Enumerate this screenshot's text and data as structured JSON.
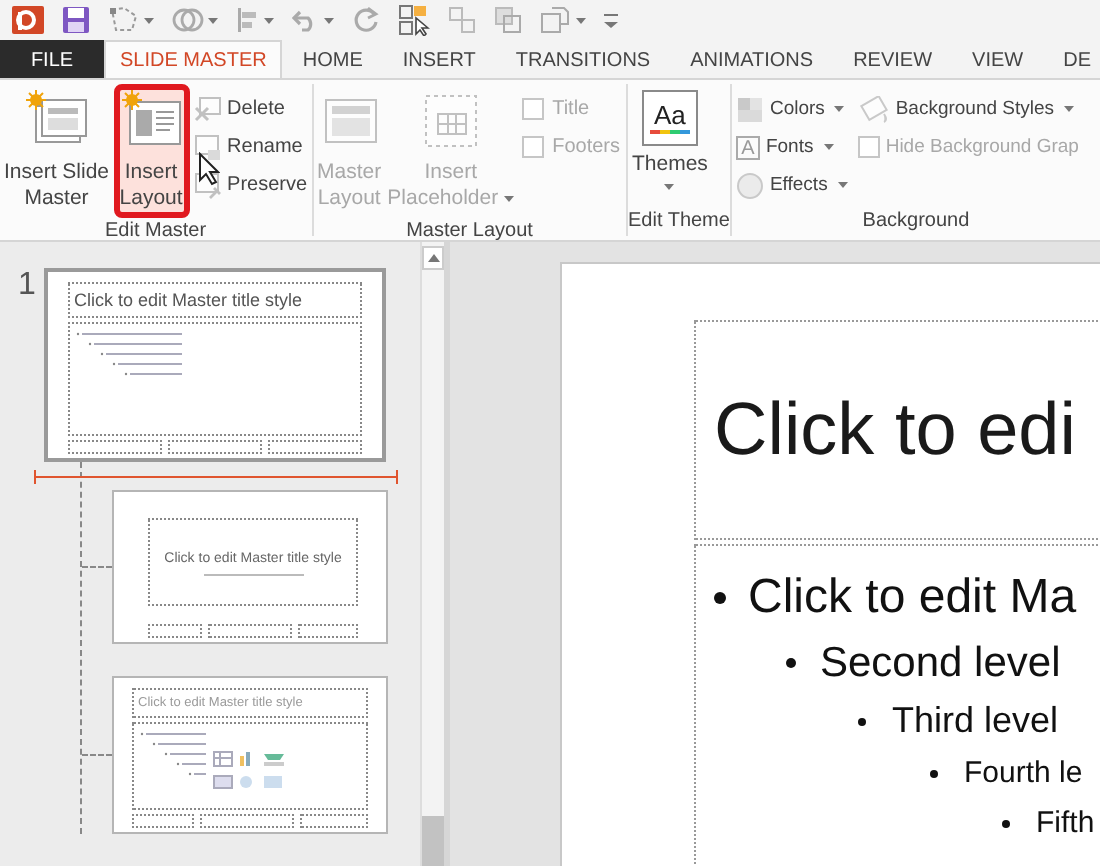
{
  "tabs": [
    {
      "label": "FILE",
      "kind": "file",
      "selected": false
    },
    {
      "label": "SLIDE MASTER",
      "kind": "tab",
      "selected": true
    },
    {
      "label": "HOME",
      "kind": "tab",
      "selected": false
    },
    {
      "label": "INSERT",
      "kind": "tab",
      "selected": false
    },
    {
      "label": "TRANSITIONS",
      "kind": "tab",
      "selected": false
    },
    {
      "label": "ANIMATIONS",
      "kind": "tab",
      "selected": false
    },
    {
      "label": "REVIEW",
      "kind": "tab",
      "selected": false
    },
    {
      "label": "VIEW",
      "kind": "tab",
      "selected": false
    },
    {
      "label": "DE",
      "kind": "tab",
      "selected": false
    }
  ],
  "ribbon": {
    "groups": [
      {
        "label": "Edit Master",
        "columns": [
          {
            "kind": "large",
            "lines": [
              "Insert Slide",
              "Master"
            ],
            "disabled": false,
            "highlighted": false,
            "dropdown": false
          },
          {
            "kind": "large",
            "lines": [
              "Insert",
              "Layout"
            ],
            "disabled": false,
            "highlighted": true,
            "dropdown": false
          },
          {
            "kind": "stack",
            "items": [
              {
                "kind": "button",
                "label": "Delete",
                "disabled": true,
                "dropdown": false
              },
              {
                "kind": "button",
                "label": "Rename",
                "disabled": true,
                "dropdown": false
              },
              {
                "kind": "button",
                "label": "Preserve",
                "disabled": true,
                "dropdown": false
              }
            ]
          }
        ]
      },
      {
        "label": "Master Layout",
        "columns": [
          {
            "kind": "large",
            "lines": [
              "Master",
              "Layout"
            ],
            "disabled": true,
            "highlighted": false,
            "dropdown": false
          },
          {
            "kind": "large",
            "lines": [
              "Insert",
              "Placeholder"
            ],
            "disabled": true,
            "highlighted": false,
            "dropdown": true
          },
          {
            "kind": "stack",
            "items": [
              {
                "kind": "checkbox",
                "label": "Title",
                "disabled": true,
                "checked": false
              },
              {
                "kind": "checkbox",
                "label": "Footers",
                "disabled": true,
                "checked": false
              }
            ]
          }
        ]
      },
      {
        "label": "Edit Theme",
        "columns": [
          {
            "kind": "large",
            "lines": [
              "Themes"
            ],
            "icon_label": "Aa",
            "disabled": false,
            "highlighted": false,
            "dropdown": true
          }
        ]
      },
      {
        "label": "Background",
        "columns": [
          {
            "kind": "stack",
            "items": [
              {
                "kind": "button",
                "label": "Colors",
                "disabled": true,
                "dropdown": true
              },
              {
                "kind": "button",
                "label": "Fonts",
                "icon_label": "A",
                "disabled": true,
                "dropdown": true
              },
              {
                "kind": "button",
                "label": "Effects",
                "disabled": true,
                "dropdown": true
              }
            ]
          },
          {
            "kind": "stack",
            "items": [
              {
                "kind": "button",
                "label": "Background Styles",
                "disabled": true,
                "dropdown": true
              },
              {
                "kind": "checkbox",
                "label": "Hide Background Grap",
                "disabled": true,
                "checked": false
              }
            ]
          }
        ]
      }
    ]
  },
  "thumbnails": [
    {
      "number": "1",
      "kind": "master",
      "selected": true,
      "title": "Click to edit Master title style",
      "drop_marker": true,
      "children": [
        {
          "kind": "title",
          "selected": false,
          "title": "Click to edit Master title style"
        },
        {
          "kind": "content",
          "selected": false,
          "title": "Click to edit Master title style"
        }
      ]
    }
  ],
  "slide": {
    "title": "Click to edi",
    "bullets": [
      {
        "text": "Click to edit Ma",
        "children": [
          {
            "text": "Second level",
            "children": [
              {
                "text": "Third level",
                "children": [
                  {
                    "text": "Fourth le",
                    "children": [
                      {
                        "text": "Fifth"
                      }
                    ]
                  }
                ]
              }
            ]
          }
        ]
      }
    ]
  }
}
